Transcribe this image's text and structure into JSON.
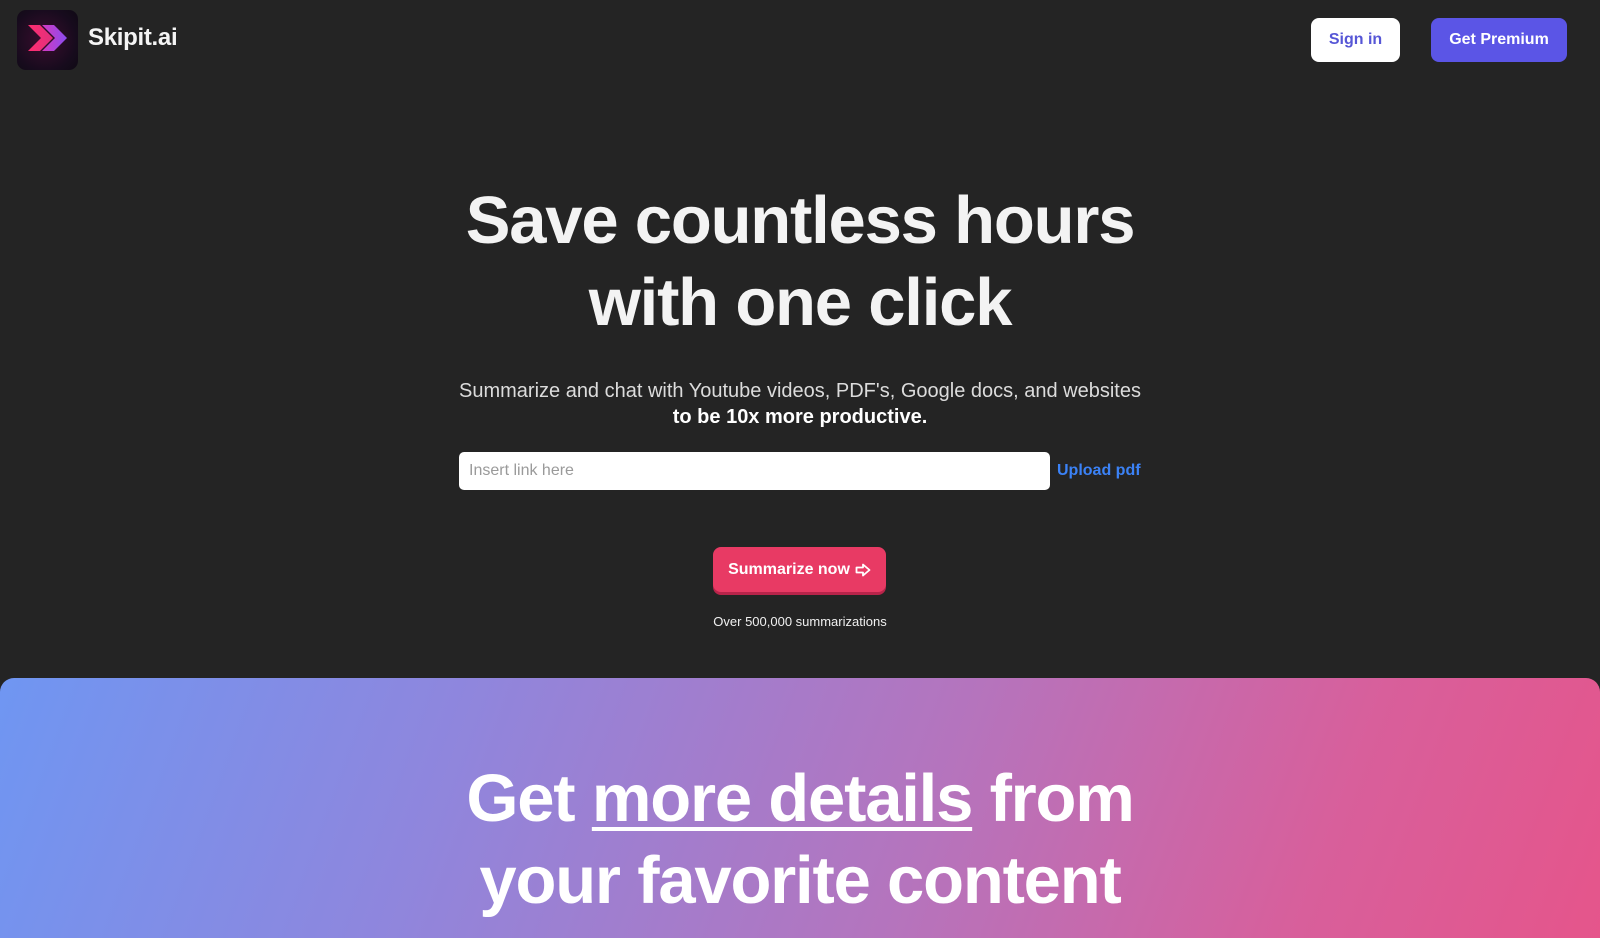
{
  "header": {
    "brand": "Skipit.ai",
    "signin_label": "Sign in",
    "premium_label": "Get Premium"
  },
  "hero": {
    "title_line1": "Save countless hours",
    "title_line2": "with one click",
    "subtitle": "Summarize and chat with Youtube videos, PDF's, Google docs, and websites",
    "subtitle_bold": "to be 10x more productive.",
    "input_placeholder": "Insert link here",
    "upload_label": "Upload pdf",
    "summarize_label": "Summarize now",
    "stat": "Over 500,000 summarizations"
  },
  "feature": {
    "title_prefix": "Get ",
    "title_emphasis": "more details",
    "title_suffix": " from",
    "title_line2": "your favorite content"
  },
  "icons": {
    "logo": "chevrons-right-icon",
    "summarize": "arrow-right-icon"
  },
  "colors": {
    "background": "#242424",
    "premium": "#5b55e6",
    "summarize": "#e83a64",
    "upload_link": "#3b82f6"
  }
}
